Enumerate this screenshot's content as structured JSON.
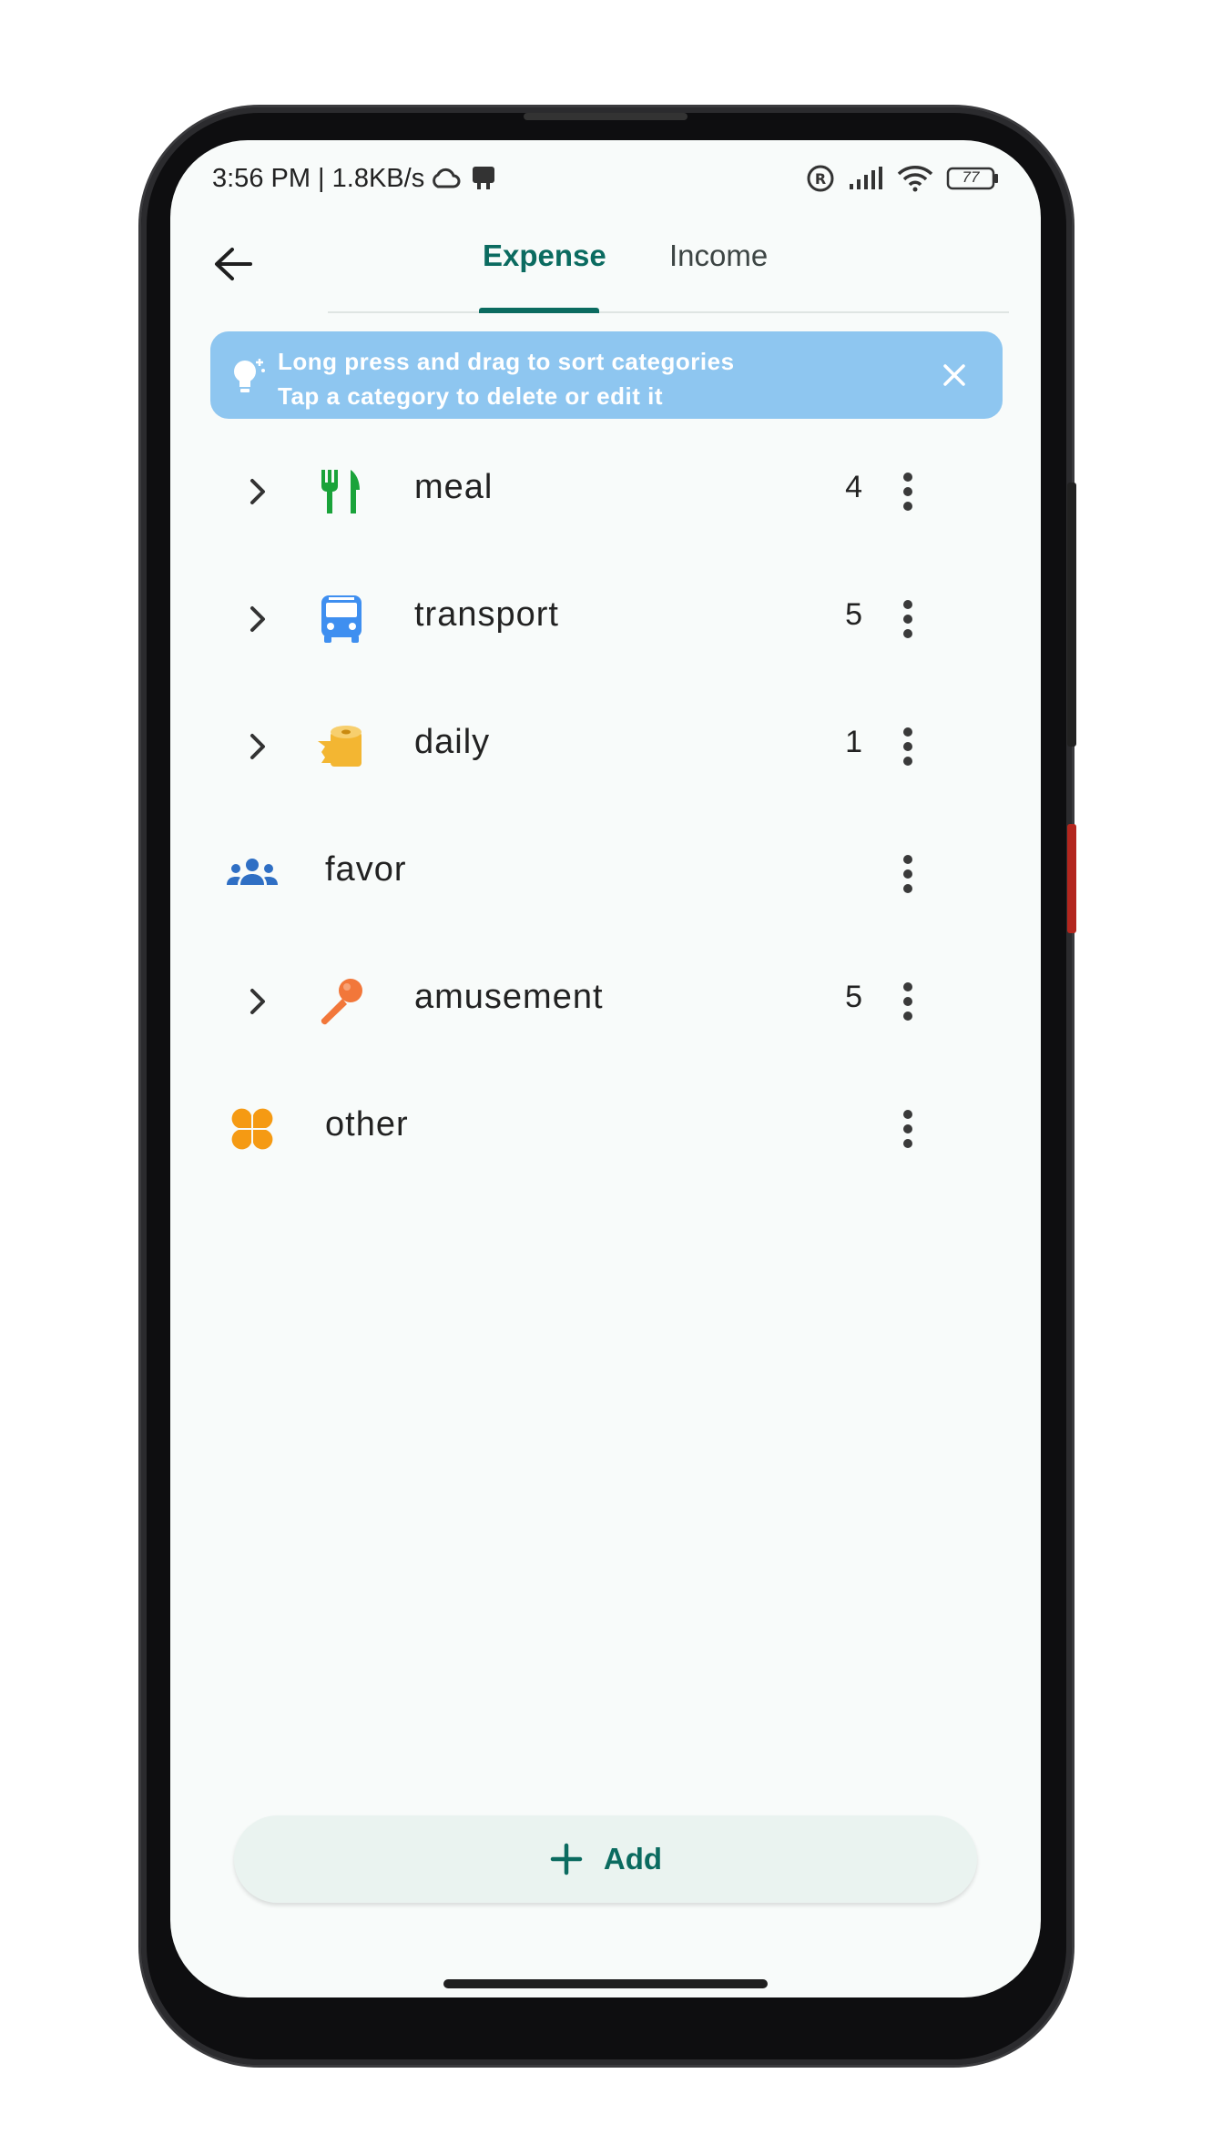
{
  "status_bar": {
    "time": "3:56 PM | 1.8KB/s",
    "battery": "77"
  },
  "tabs": [
    {
      "label": "Expense",
      "selected": true
    },
    {
      "label": "Income",
      "selected": false
    }
  ],
  "tip": {
    "line1": "Long press and drag to sort categories",
    "line2": "Tap a category to delete or edit it"
  },
  "categories": [
    {
      "label": "meal",
      "count": "4",
      "icon": "fork-knife-icon",
      "color": "#1aa33a",
      "expandable": true
    },
    {
      "label": "transport",
      "count": "5",
      "icon": "bus-icon",
      "color": "#3f8ff0",
      "expandable": true
    },
    {
      "label": "daily",
      "count": "1",
      "icon": "toilet-paper-icon",
      "color": "#f3b632",
      "expandable": true
    },
    {
      "label": "favor",
      "count": "",
      "icon": "people-icon",
      "color": "#2f6fc4",
      "expandable": false
    },
    {
      "label": "amusement",
      "count": "5",
      "icon": "microphone-icon",
      "color": "#f2773a",
      "expandable": true
    },
    {
      "label": "other",
      "count": "",
      "icon": "clover-icon",
      "color": "#f59a13",
      "expandable": false
    }
  ],
  "add_button": {
    "label": "Add"
  },
  "colors": {
    "accent": "#0b6b60",
    "tip_bg": "#8ec6f0",
    "screen_bg": "#f8fbfa"
  }
}
